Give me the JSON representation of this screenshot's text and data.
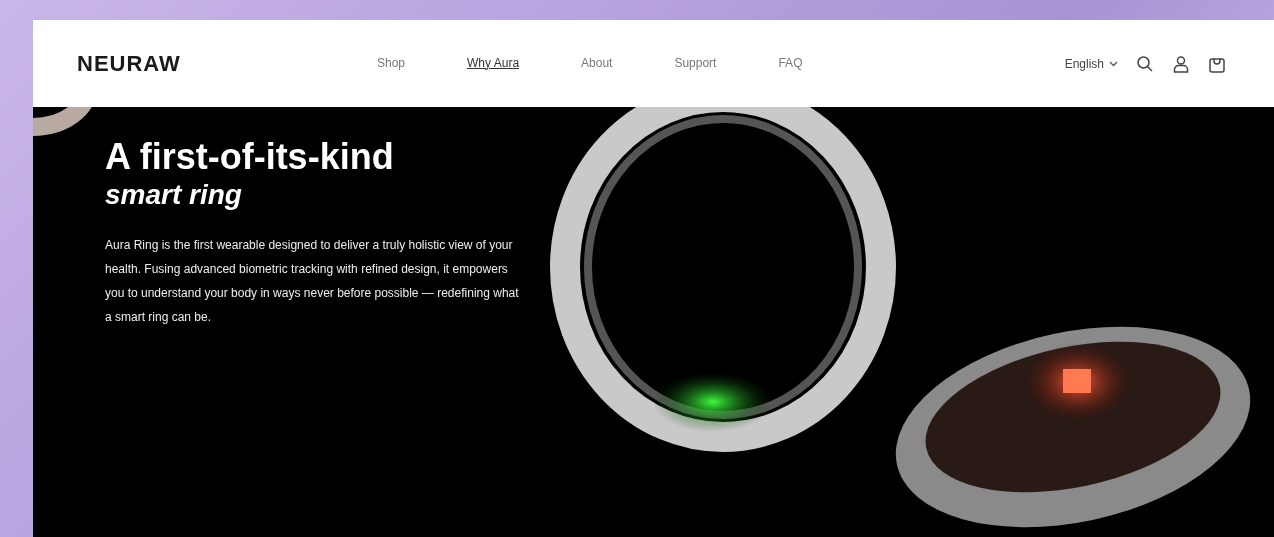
{
  "header": {
    "logo": "NEURAW",
    "nav": [
      {
        "label": "Shop",
        "selected": false
      },
      {
        "label": "Why Aura",
        "selected": true
      },
      {
        "label": "About",
        "selected": false
      },
      {
        "label": "Support",
        "selected": false
      },
      {
        "label": "FAQ",
        "selected": false
      }
    ],
    "language": "English"
  },
  "hero": {
    "title": "A first-of-its-kind",
    "subtitle": "smart ring",
    "body": "Aura Ring is the first wearable designed to deliver a truly holistic view of your health. Fusing advanced biometric tracking with refined design, it empowers you to understand your body in ways never before possible — redefining what a smart ring can be."
  }
}
